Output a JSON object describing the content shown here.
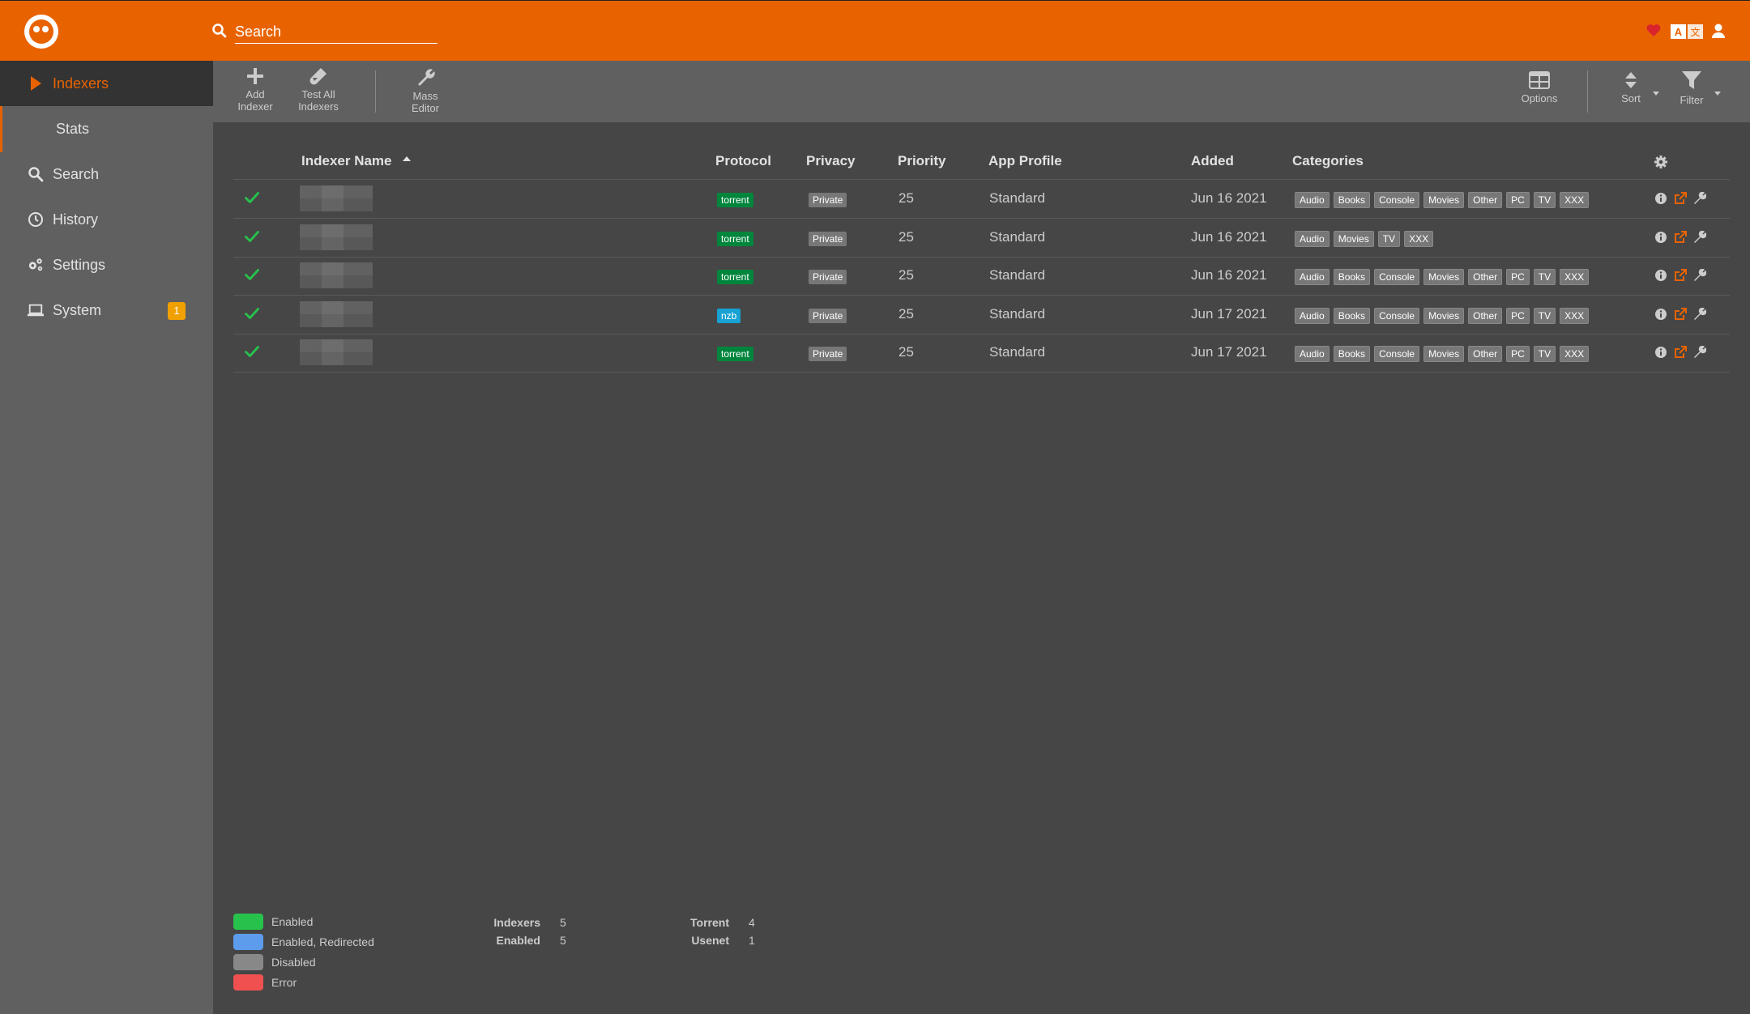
{
  "app": {
    "accent": "#e86300"
  },
  "header": {
    "search_placeholder": "Search",
    "icons": [
      "heart-icon",
      "translate-icon",
      "user-icon"
    ]
  },
  "sidebar": {
    "items": [
      {
        "label": "Indexers",
        "icon": "play-icon",
        "active": true
      },
      {
        "label": "Stats",
        "icon": "",
        "sub": true
      },
      {
        "label": "Search",
        "icon": "search-icon"
      },
      {
        "label": "History",
        "icon": "clock-icon"
      },
      {
        "label": "Settings",
        "icon": "gears-icon"
      },
      {
        "label": "System",
        "icon": "laptop-icon",
        "badge": "1"
      }
    ]
  },
  "toolbar": {
    "add": [
      "Add",
      "Indexer"
    ],
    "test": [
      "Test All",
      "Indexers"
    ],
    "mass": [
      "Mass",
      "Editor"
    ],
    "options": "Options",
    "sort": "Sort",
    "filter": "Filter"
  },
  "table": {
    "headers": {
      "name": "Indexer Name",
      "protocol": "Protocol",
      "privacy": "Privacy",
      "priority": "Priority",
      "app_profile": "App Profile",
      "added": "Added",
      "categories": "Categories"
    },
    "rows": [
      {
        "protocol": "torrent",
        "privacy": "Private",
        "priority": "25",
        "app_profile": "Standard",
        "added": "Jun 16 2021",
        "categories": [
          "Audio",
          "Books",
          "Console",
          "Movies",
          "Other",
          "PC",
          "TV",
          "XXX"
        ]
      },
      {
        "protocol": "torrent",
        "privacy": "Private",
        "priority": "25",
        "app_profile": "Standard",
        "added": "Jun 16 2021",
        "categories": [
          "Audio",
          "Movies",
          "TV",
          "XXX"
        ]
      },
      {
        "protocol": "torrent",
        "privacy": "Private",
        "priority": "25",
        "app_profile": "Standard",
        "added": "Jun 16 2021",
        "categories": [
          "Audio",
          "Books",
          "Console",
          "Movies",
          "Other",
          "PC",
          "TV",
          "XXX"
        ]
      },
      {
        "protocol": "nzb",
        "privacy": "Private",
        "priority": "25",
        "app_profile": "Standard",
        "added": "Jun 17 2021",
        "categories": [
          "Audio",
          "Books",
          "Console",
          "Movies",
          "Other",
          "PC",
          "TV",
          "XXX"
        ]
      },
      {
        "protocol": "torrent",
        "privacy": "Private",
        "priority": "25",
        "app_profile": "Standard",
        "added": "Jun 17 2021",
        "categories": [
          "Audio",
          "Books",
          "Console",
          "Movies",
          "Other",
          "PC",
          "TV",
          "XXX"
        ]
      }
    ]
  },
  "legend": [
    {
      "label": "Enabled",
      "color": "#27c24c"
    },
    {
      "label": "Enabled, Redirected",
      "color": "#5d9cec"
    },
    {
      "label": "Disabled",
      "color": "#888888"
    },
    {
      "label": "Error",
      "color": "#f05050"
    }
  ],
  "stats": {
    "indexers_label": "Indexers",
    "indexers_value": "5",
    "enabled_label": "Enabled",
    "enabled_value": "5",
    "torrent_label": "Torrent",
    "torrent_value": "4",
    "usenet_label": "Usenet",
    "usenet_value": "1"
  }
}
